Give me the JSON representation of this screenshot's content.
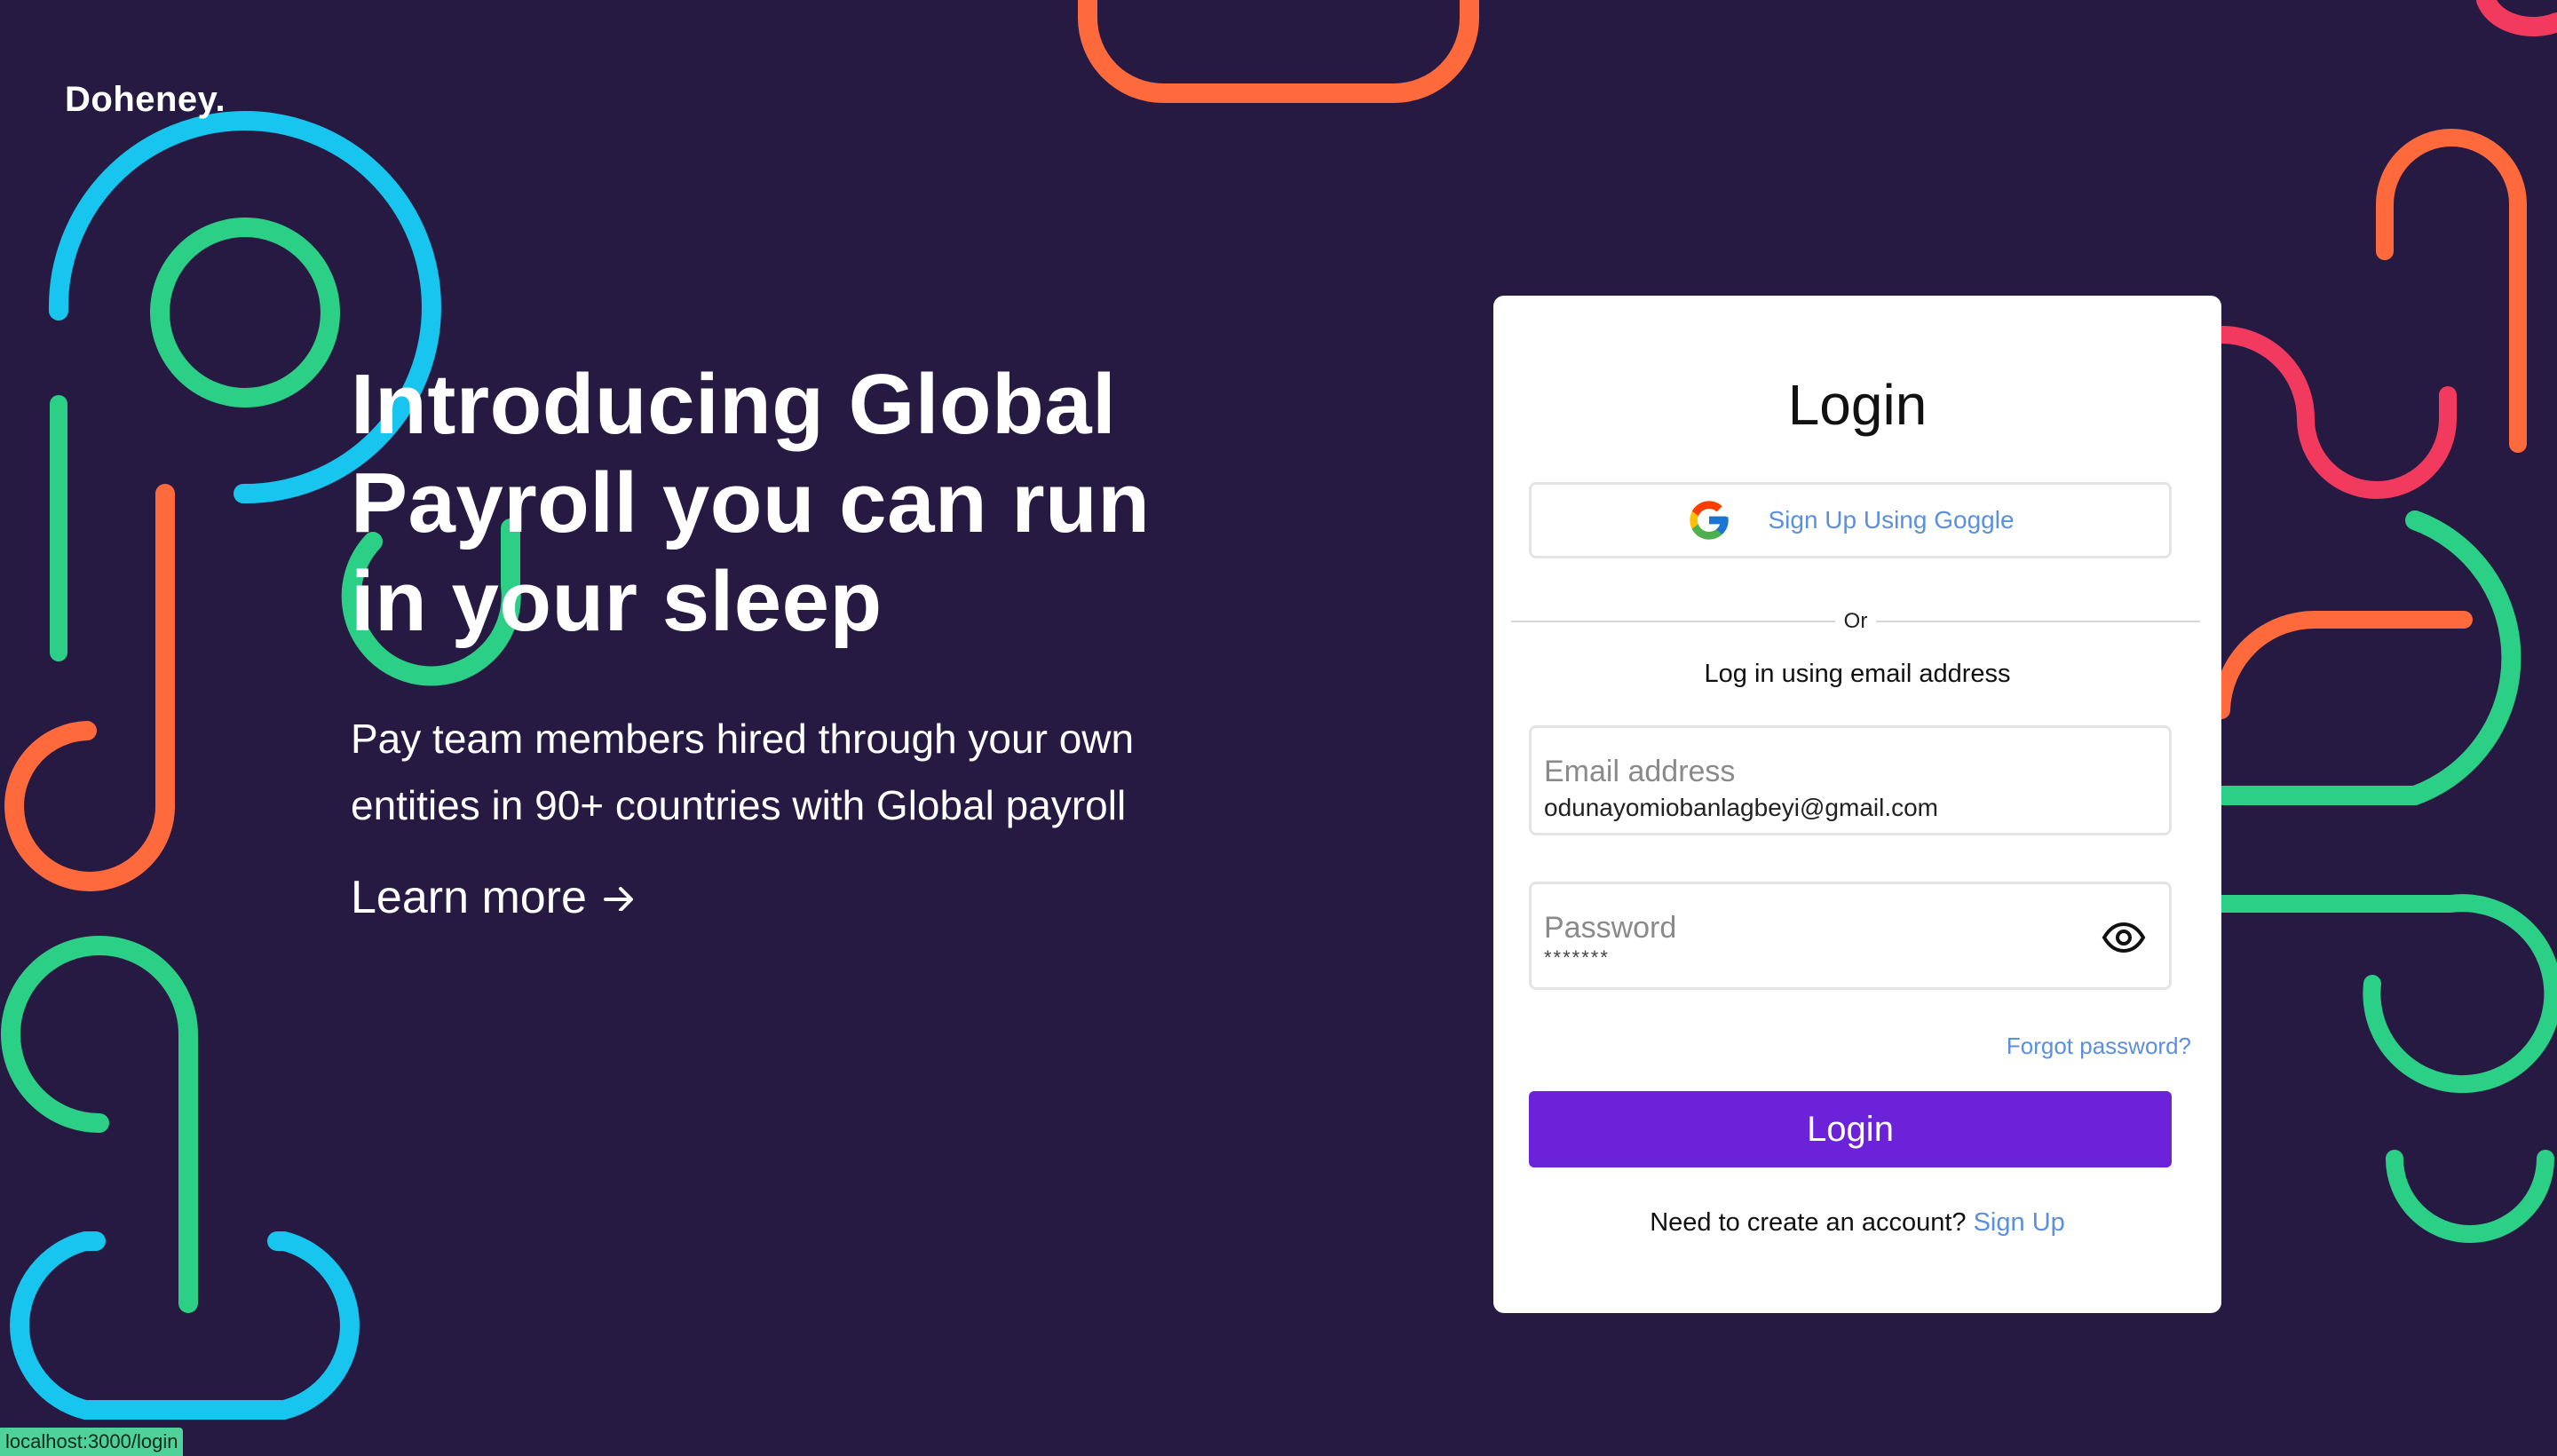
{
  "brand": {
    "logo": "Doheney."
  },
  "hero": {
    "title_lines": [
      "Introducing Global",
      "Payroll you can run",
      "in your sleep"
    ],
    "subtitle_lines": [
      "Pay team members hired through your own",
      "entities in 90+ countries with Global payroll"
    ],
    "learn_more": "Learn more"
  },
  "login_card": {
    "title": "Login",
    "google_button": {
      "label": "Sign Up Using Goggle",
      "icon": "google-icon"
    },
    "divider_text": "Or",
    "email_hint": "Log in using email address",
    "email_field": {
      "label": "Email address",
      "value": "odunayomiobanlagbeyi@gmail.com"
    },
    "password_field": {
      "label": "Password",
      "value": "*******",
      "icon": "eye-icon"
    },
    "forgot_password": "Forgot password?",
    "submit_label": "Login",
    "signup_prompt": "Need to create an account?",
    "signup_link": "Sign Up"
  },
  "status_bar": {
    "url": "localhost:3000/login"
  },
  "colors": {
    "background": "#261a43",
    "primary_button": "#6b22d8",
    "link": "#5b8fe0",
    "deco_cyan": "#17c5ee",
    "deco_green": "#2ccf86",
    "deco_orange": "#ff6a3d",
    "deco_pink": "#f23a5f"
  }
}
